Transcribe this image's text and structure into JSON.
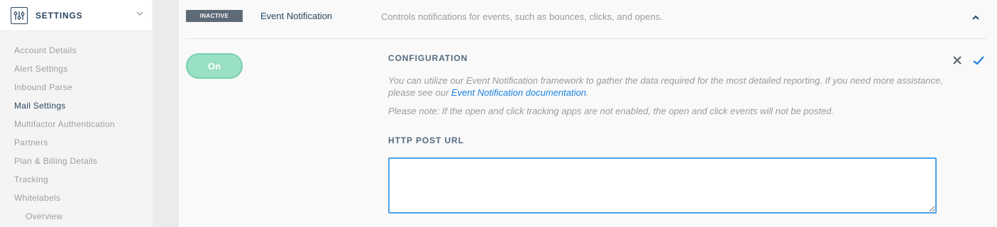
{
  "sidebar": {
    "title": "SETTINGS",
    "items": [
      {
        "label": "Account Details"
      },
      {
        "label": "Alert Settings"
      },
      {
        "label": "Inbound Parse"
      },
      {
        "label": "Mail Settings",
        "active": true
      },
      {
        "label": "Multifactor Authentication"
      },
      {
        "label": "Partners"
      },
      {
        "label": "Plan & Billing Details"
      },
      {
        "label": "Tracking"
      },
      {
        "label": "Whitelabels"
      },
      {
        "label": "Overview",
        "sub": true
      }
    ]
  },
  "setting": {
    "status": "INACTIVE",
    "title": "Event Notification",
    "description": "Controls notifications for events, such as bounces, clicks, and opens.",
    "toggle_label": "On"
  },
  "config": {
    "title": "CONFIGURATION",
    "text_before_link": "You can utilize our Event Notification framework to gather the data required for the most detailed reporting. If you need more assistance, please see our ",
    "link_text": "Event Notification documentation",
    "text_after_link": ".",
    "note": "Please note: If the open and click tracking apps are not enabled, the open and click events will not be posted.",
    "field_label": "HTTP POST URL",
    "field_value": "",
    "field_placeholder": ""
  },
  "icons": {
    "settings": "sliders-icon",
    "chevron": "chevron-down-icon",
    "collapse": "chevron-up-icon",
    "cancel": "close-icon",
    "save": "checkmark-icon"
  },
  "colors": {
    "primary_text": "#294661",
    "muted_text": "#9b9b9b",
    "link": "#1a82e2",
    "badge_bg": "#5e6a76",
    "toggle_bg": "#99e0c4",
    "input_border": "#4aa2e8"
  }
}
